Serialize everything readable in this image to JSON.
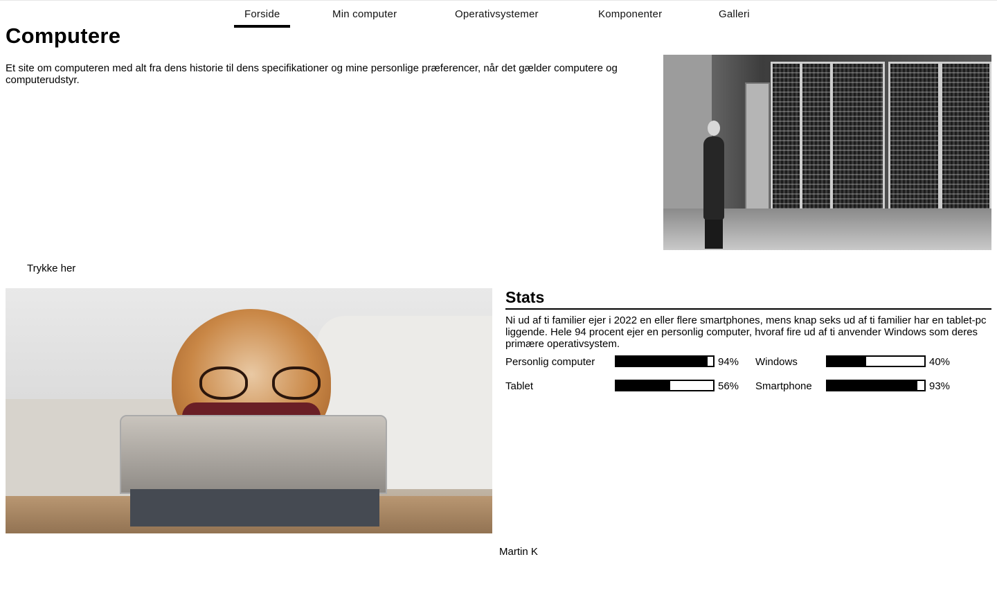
{
  "nav": {
    "items": [
      "Forside",
      "Min computer",
      "Operativsystemer",
      "Komponenter",
      "Galleri"
    ],
    "active": "Forside"
  },
  "hero": {
    "title": "Computere",
    "intro": "Et site om computeren med alt fra dens historie til dens specifikationer og mine personlige præferencer, når det gælder computere og computerudstyr.",
    "cta": "Trykke her"
  },
  "stats": {
    "title": "Stats",
    "text": "Ni ud af ti familier ejer i 2022 en eller flere smartphones, mens knap seks ud af ti familier har en tablet-pc liggende. Hele 94 procent ejer en personlig computer, hvoraf fire ud af ti anvender Windows som deres primære operativsystem.",
    "items": [
      {
        "label": "Personlig computer",
        "percent": 94,
        "percent_label": "94%"
      },
      {
        "label": "Windows",
        "percent": 40,
        "percent_label": "40%"
      },
      {
        "label": "Tablet",
        "percent": 56,
        "percent_label": "56%"
      },
      {
        "label": "Smartphone",
        "percent": 93,
        "percent_label": "93%"
      }
    ]
  },
  "footer": {
    "author": "Martin K"
  },
  "colors": {
    "text": "#000000",
    "background": "#ffffff",
    "bar_fill": "#000000"
  }
}
